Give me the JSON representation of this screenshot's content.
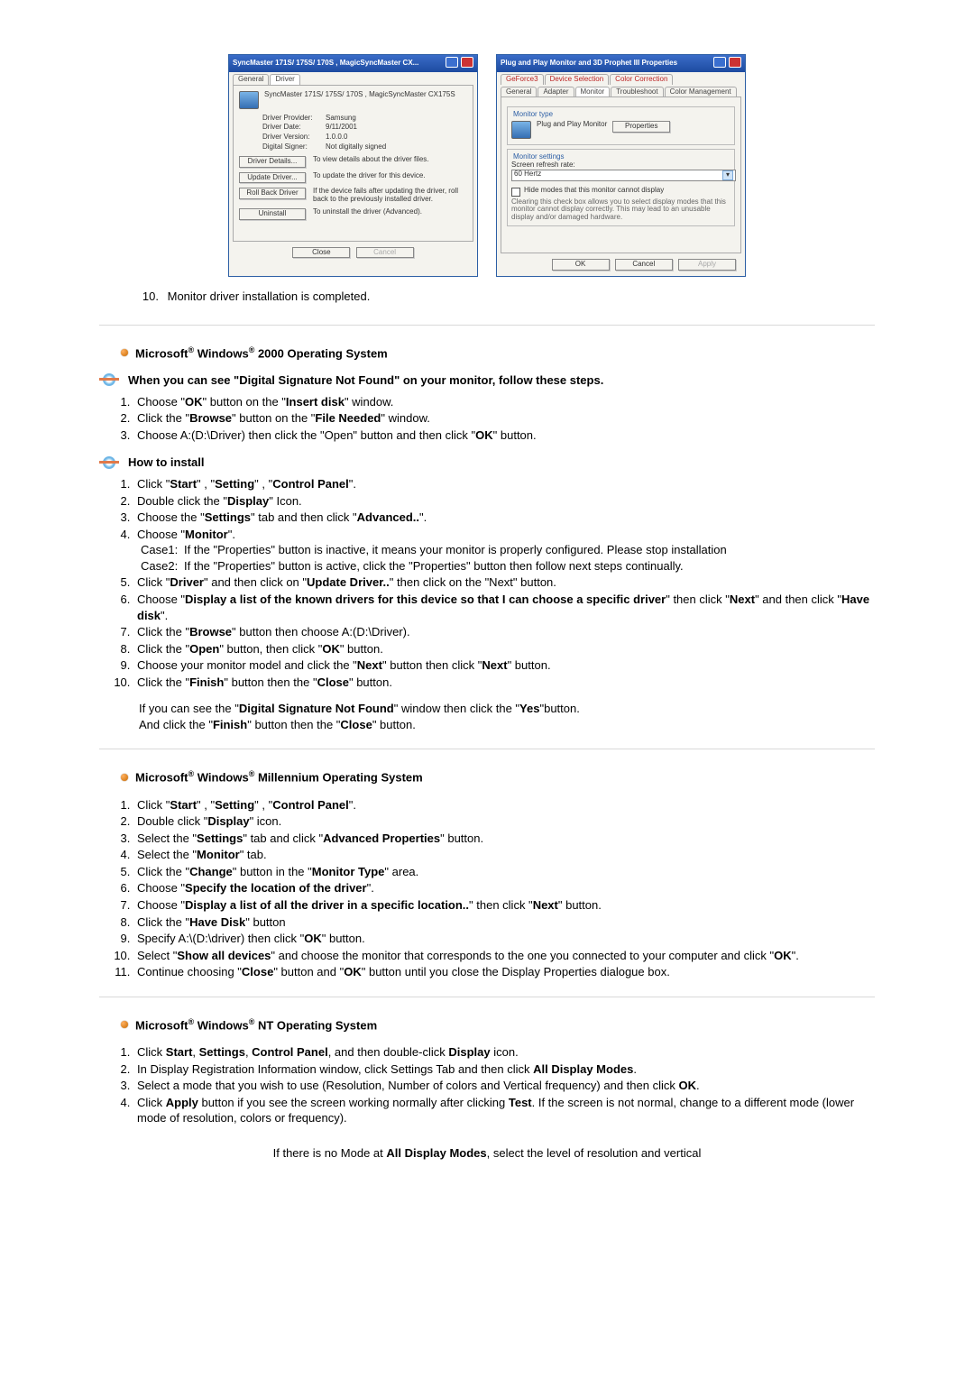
{
  "win1": {
    "title": "SyncMaster 171S/ 175S/ 170S , MagicSyncMaster CX...",
    "tabs": {
      "general": "General",
      "driver": "Driver"
    },
    "model": "SyncMaster 171S/ 175S/ 170S , MagicSyncMaster CX175S",
    "provider_k": "Driver Provider:",
    "provider_v": "Samsung",
    "date_k": "Driver Date:",
    "date_v": "9/11/2001",
    "version_k": "Driver Version:",
    "version_v": "1.0.0.0",
    "signer_k": "Digital Signer:",
    "signer_v": "Not digitally signed",
    "details_btn": "Driver Details...",
    "details_txt": "To view details about the driver files.",
    "update_btn": "Update Driver...",
    "update_txt": "To update the driver for this device.",
    "rollback_btn": "Roll Back Driver",
    "rollback_txt": "If the device fails after updating the driver, roll back to the previously installed driver.",
    "uninstall_btn": "Uninstall",
    "uninstall_txt": "To uninstall the driver (Advanced).",
    "close": "Close",
    "cancel": "Cancel"
  },
  "win2": {
    "title": "Plug and Play Monitor and 3D Prophet III Properties",
    "tabs": {
      "geforce": "GeForce3",
      "devsel": "Device Selection",
      "colcorr": "Color Correction",
      "general": "General",
      "adapter": "Adapter",
      "monitor": "Monitor",
      "trouble": "Troubleshoot",
      "colmgmt": "Color Management"
    },
    "grp_type": "Monitor type",
    "type_txt": "Plug and Play Monitor",
    "props_btn": "Properties",
    "grp_set": "Monitor settings",
    "refresh_lbl": "Screen refresh rate:",
    "refresh_val": "60 Hertz",
    "hide_chk": "Hide modes that this monitor cannot display",
    "hide_desc": "Clearing this check box allows you to select display modes that this monitor cannot display correctly. This may lead to an unusable display and/or damaged hardware.",
    "ok": "OK",
    "cancel": "Cancel",
    "apply": "Apply"
  },
  "step10": {
    "num": "10.",
    "text": "Monitor driver installation is completed."
  },
  "os2000": {
    "head_pre": "Microsoft",
    "head_mid": " Windows",
    "head_suf": " 2000 Operating System",
    "sub1": "When you can see \"Digital Signature Not Found\" on your monitor, follow these steps.",
    "s1": [
      "Choose \"",
      "OK",
      "\" button on the \"",
      "Insert disk",
      "\" window."
    ],
    "s2": [
      "Click the \"",
      "Browse",
      "\" button on the \"",
      "File Needed",
      "\" window."
    ],
    "s3": "Choose A:(D:\\Driver) then click the \"Open\" button and then click \"",
    "s3b": "OK",
    "s3c": "\" button.",
    "sub2": "How to install",
    "h1": [
      "Click \"",
      "Start",
      "\" , \"",
      "Setting",
      "\" , \"",
      "Control Panel",
      "\"."
    ],
    "h2": [
      "Double click the \"",
      "Display",
      "\" Icon."
    ],
    "h3": [
      "Choose the \"",
      "Settings",
      "\" tab and then click \"",
      "Advanced..",
      "\"."
    ],
    "h4": [
      "Choose \"",
      "Monitor",
      "\"."
    ],
    "case1_lbl": "Case1:",
    "case1_txt": "If the \"Properties\" button is inactive, it means your monitor is properly configured. Please stop installation",
    "case2_lbl": "Case2:",
    "case2_txt": "If the \"Properties\" button is active, click the \"Properties\" button then follow next steps continually.",
    "h5": [
      "Click \"",
      "Driver",
      "\" and then click on \"",
      "Update Driver..",
      "\" then click on the \"Next\" button."
    ],
    "h6a": "Choose \"",
    "h6b": "Display a list of the known drivers for this device so that I can choose a specific driver",
    "h6c": "\" then click \"",
    "h6d": "Next",
    "h6e": "\" and then click \"",
    "h6f": "Have disk",
    "h6g": "\".",
    "h7": [
      "Click the \"",
      "Browse",
      "\" button then choose A:(D:\\Driver)."
    ],
    "h8": [
      "Click the \"",
      "Open",
      "\" button, then click \"",
      "OK",
      "\" button."
    ],
    "h9": [
      "Choose your monitor model and click the \"",
      "Next",
      "\" button then click \"",
      "Next",
      "\" button."
    ],
    "h10": [
      "Click the \"",
      "Finish",
      "\" button then the \"",
      "Close",
      "\" button."
    ],
    "note1": [
      "If you can see the \"",
      "Digital Signature Not Found",
      "\" window then click the \"",
      "Yes",
      "\"button."
    ],
    "note2": [
      "And click the \"",
      "Finish",
      "\" button then the \"",
      "Close",
      "\" button."
    ]
  },
  "osme": {
    "head_suf": " Millennium Operating System",
    "m1": [
      "Click \"",
      "Start",
      "\" , \"",
      "Setting",
      "\" , \"",
      "Control Panel",
      "\"."
    ],
    "m2": [
      "Double click \"",
      "Display",
      "\" icon."
    ],
    "m3": [
      "Select the \"",
      "Settings",
      "\" tab and click \"",
      "Advanced Properties",
      "\" button."
    ],
    "m4": [
      "Select the \"",
      "Monitor",
      "\" tab."
    ],
    "m5": [
      "Click the \"",
      "Change",
      "\" button in the \"",
      "Monitor Type",
      "\" area."
    ],
    "m6": [
      "Choose \"",
      "Specify the location of the driver",
      "\"."
    ],
    "m7": [
      "Choose \"",
      "Display a list of all the driver in a specific location..",
      "\" then click \"",
      "Next",
      "\" button."
    ],
    "m8": [
      "Click the \"",
      "Have Disk",
      "\" button"
    ],
    "m9": [
      "Specify A:\\(D:\\driver) then click \"",
      "OK",
      "\" button."
    ],
    "m10": [
      "Select \"",
      "Show all devices",
      "\" and choose the monitor that corresponds to the one you connected to your computer and click \"",
      "OK",
      "\"."
    ],
    "m11a": "Continue choosing \"",
    "m11b": "Close",
    "m11c": "\" button and \"",
    "m11d": "OK",
    "m11e": "\" button until you close the Display Properties dialogue box."
  },
  "osnt": {
    "head_suf": " NT Operating System",
    "n1": [
      "Click ",
      "Start",
      ", ",
      "Settings",
      ", ",
      "Control Panel",
      ", and then double-click ",
      "Display",
      " icon."
    ],
    "n2a": "In Display Registration Information window, click Settings Tab and then click ",
    "n2b": "All Display Modes",
    "n2c": ".",
    "n3a": "Select a mode that you wish to use (Resolution, Number of colors and Vertical frequency) and then click ",
    "n3b": "OK",
    "n3c": ".",
    "n4a": "Click ",
    "n4b": "Apply",
    "n4c": " button if you see the screen working normally after clicking ",
    "n4d": "Test",
    "n4e": ". If the screen is not normal, change to a different mode (lower mode of resolution, colors or frequency).",
    "trail_a": "If there is no Mode at ",
    "trail_b": "All Display Modes",
    "trail_c": ", select the level of resolution and vertical"
  }
}
